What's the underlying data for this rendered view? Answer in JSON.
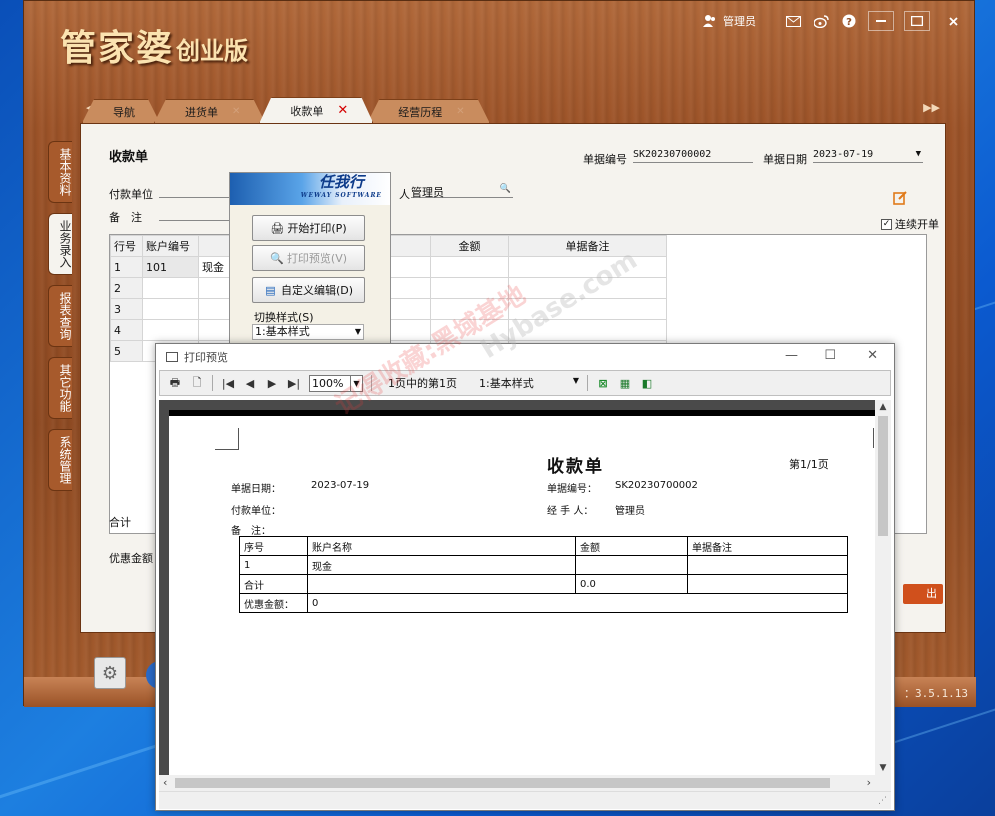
{
  "app": {
    "logo_main": "管家婆",
    "logo_sub": "创业版",
    "user": "管理员",
    "version": "：3.5.1.13"
  },
  "tabs": [
    {
      "label": "导航",
      "active": false,
      "closable": false
    },
    {
      "label": "进货单",
      "active": false,
      "closable": true
    },
    {
      "label": "收款单",
      "active": true,
      "closable": true
    },
    {
      "label": "经营历程",
      "active": false,
      "closable": true
    }
  ],
  "side_tabs": [
    "基本资料",
    "业务录入",
    "报表查询",
    "其它功能",
    "系统管理"
  ],
  "form": {
    "title": "收款单",
    "doc_no_label": "单据编号",
    "doc_no": "SK20230700002",
    "doc_date_label": "单据日期",
    "doc_date": "2023-07-19",
    "payer_label": "付款单位",
    "handler_suffix": "人",
    "handler": "管理员",
    "remark_label": "备　注",
    "continuous_label": "连续开单",
    "grid_headers": [
      "行号",
      "账户编号",
      "",
      "金额",
      "单据备注"
    ],
    "rows": [
      {
        "no": "1",
        "code": "101",
        "name": "现金"
      },
      {
        "no": "2",
        "code": "",
        "name": ""
      },
      {
        "no": "3",
        "code": "",
        "name": ""
      },
      {
        "no": "4",
        "code": "",
        "name": ""
      },
      {
        "no": "5",
        "code": "",
        "name": ""
      }
    ],
    "total_label": "合计",
    "discount_label": "优惠金额",
    "exit_label": "出"
  },
  "print_menu": {
    "brand": "任我行",
    "brand_sub": "WEWAY SOFTWARE",
    "start_print": "开始打印(P)",
    "print_preview": "打印预览(V)",
    "custom_edit": "自定义编辑(D)",
    "switch_style_label": "切换样式(S)",
    "style_value": "1:基本样式"
  },
  "preview": {
    "title": "打印预览",
    "zoom": "100%",
    "page_info": "1页中的第1页",
    "style": "1:基本样式"
  },
  "receipt": {
    "title": "收款单",
    "page": "第1/1页",
    "date_label": "单据日期：",
    "date": "2023-07-19",
    "no_label": "单据编号：",
    "no": "SK20230700002",
    "payer_label": "付款单位：",
    "handler_label": "经 手 人：",
    "handler": "管理员",
    "remark_label": "备　注：",
    "col_seq": "序号",
    "col_account": "账户名称",
    "col_amount": "金额",
    "col_remark": "单据备注",
    "row1_seq": "1",
    "row1_account": "现金",
    "total_label": "合计",
    "total_amount": "0.0",
    "discount_label": "优惠金额：",
    "discount": "0"
  },
  "watermark": {
    "cn": "记得收藏:黑域基地",
    "en": "Hybase.com"
  }
}
